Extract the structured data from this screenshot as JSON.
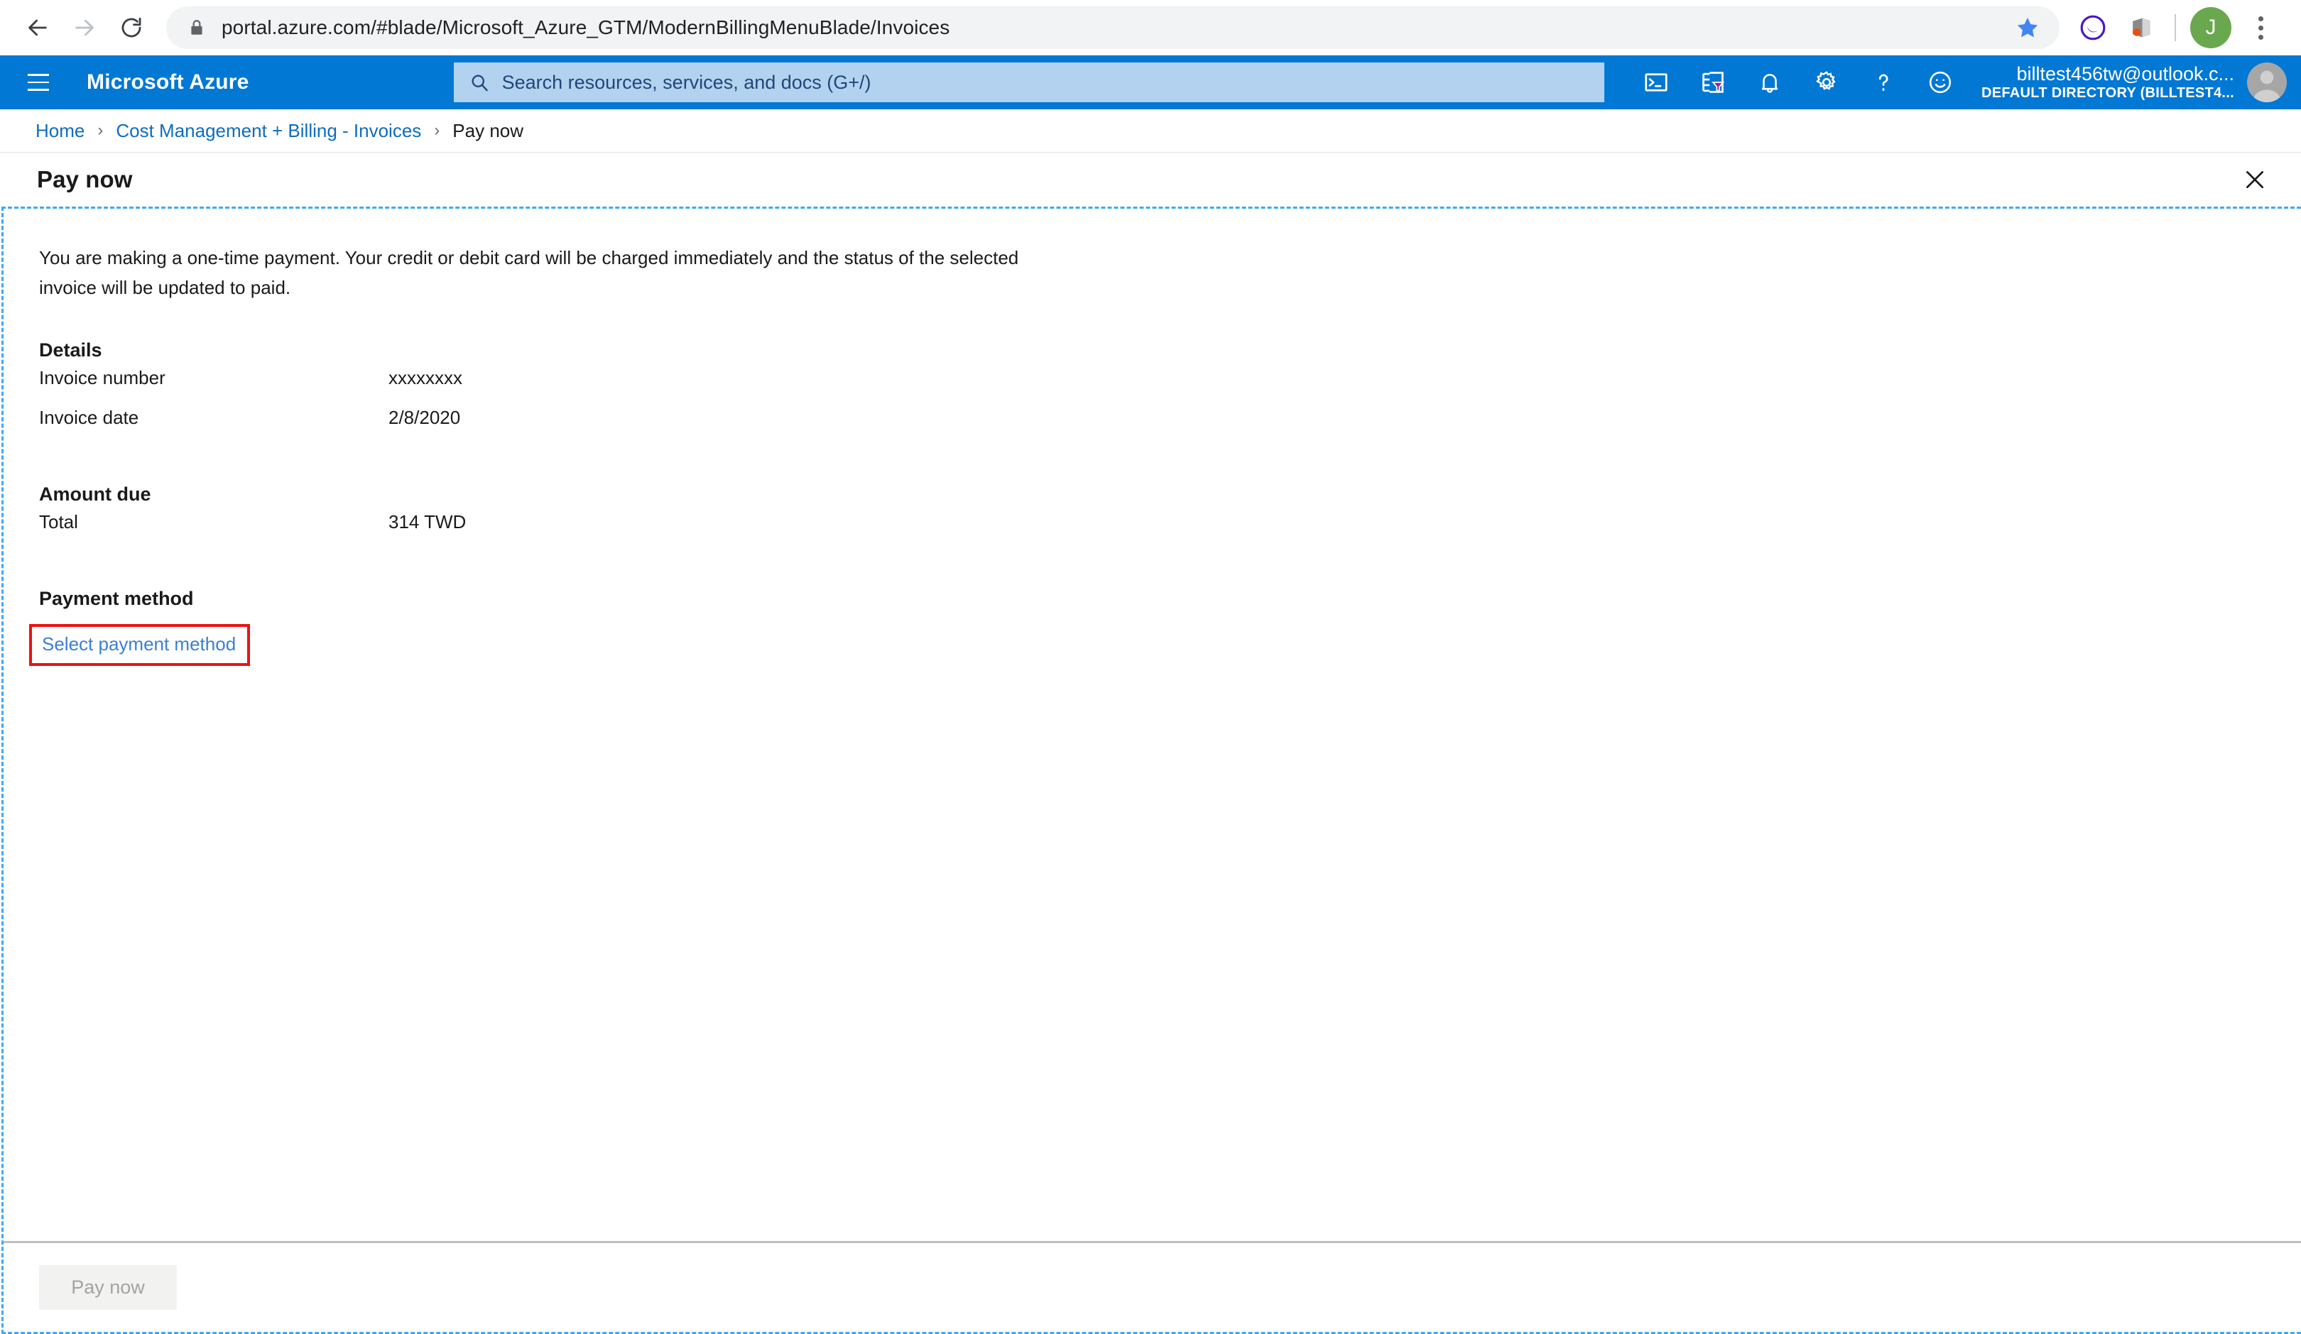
{
  "browser": {
    "back_label": "Back",
    "forward_label": "Forward",
    "reload_label": "Reload",
    "lock_icon": "lock-icon",
    "url": "portal.azure.com/#blade/Microsoft_Azure_GTM/ModernBillingMenuBlade/Invoices",
    "star_icon": "star-icon",
    "extension_icon": "extension-icon",
    "office_icon": "office-extension-icon",
    "profile_initial": "J",
    "menu_icon": "kebab-menu-icon",
    "colors": {
      "star": "#4285f4",
      "extension_purple": "#5b21b6",
      "office_orange": "#e8500e",
      "avatar_green": "#6aa84f",
      "omnibox_bg": "#f1f3f4"
    }
  },
  "azure_header": {
    "menu_icon": "hamburger-menu-icon",
    "brand": "Microsoft Azure",
    "search": {
      "icon": "search-icon",
      "placeholder": "Search resources, services, and docs (G+/)",
      "value": ""
    },
    "actions": [
      {
        "name": "cloud-shell-icon",
        "label": "Cloud Shell"
      },
      {
        "name": "directory-filter-icon",
        "label": "Directories + subscriptions"
      },
      {
        "name": "notifications-bell-icon",
        "label": "Notifications"
      },
      {
        "name": "settings-gear-icon",
        "label": "Settings"
      },
      {
        "name": "help-question-icon",
        "label": "Help"
      },
      {
        "name": "feedback-smiley-icon",
        "label": "Feedback"
      }
    ],
    "account": {
      "email": "billtest456tw@outlook.c...",
      "directory": "DEFAULT DIRECTORY (BILLTEST4...",
      "avatar_icon": "user-avatar-icon"
    },
    "colors": {
      "bar_bg": "#0078d4",
      "search_bg": "#b3d2ef",
      "search_text": "#20477a",
      "filter_accent": "#a0189f"
    }
  },
  "breadcrumb": {
    "items": [
      {
        "label": "Home",
        "current": false
      },
      {
        "label": "Cost Management + Billing - Invoices",
        "current": false
      },
      {
        "label": "Pay now",
        "current": true
      }
    ],
    "separator": "›"
  },
  "blade": {
    "title": "Pay now",
    "close_icon": "close-icon",
    "intro": "You are making a one-time payment. Your credit or debit card will be charged immediately and the status of the selected invoice will be updated to paid.",
    "details": {
      "heading": "Details",
      "rows": [
        {
          "label": "Invoice number",
          "value": "xxxxxxxx"
        },
        {
          "label": "Invoice date",
          "value": "2/8/2020"
        }
      ]
    },
    "amount_due": {
      "heading": "Amount due",
      "rows": [
        {
          "label": "Total",
          "value": "314 TWD"
        }
      ]
    },
    "payment_method": {
      "heading": "Payment method",
      "link_label": "Select payment method",
      "highlight_color": "#ee1111",
      "link_color": "#3b7fd4"
    },
    "footer": {
      "pay_now_label": "Pay now",
      "pay_now_disabled": true
    }
  }
}
